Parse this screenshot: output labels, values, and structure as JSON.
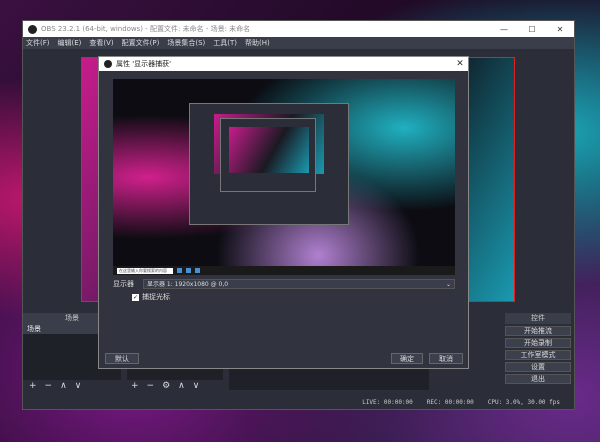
{
  "window": {
    "title": "OBS 23.2.1 (64-bit, windows) - 配置文件: 未命名 - 场景: 未命名",
    "controls": [
      "—",
      "☐",
      "✕"
    ]
  },
  "menu": [
    "文件(F)",
    "编辑(E)",
    "查看(V)",
    "配置文件(P)",
    "场景集合(S)",
    "工具(T)",
    "帮助(H)"
  ],
  "panels": {
    "scenes_title": "场景",
    "scenes_items": [
      "场景"
    ],
    "controls_title": "控件"
  },
  "controls": [
    "开始推流",
    "开始录制",
    "工作室模式",
    "设置",
    "退出"
  ],
  "toolbar_icons": [
    "+",
    "−",
    "∧",
    "∨"
  ],
  "sources_toolbar_icons": [
    "+",
    "−",
    "⚙",
    "∧",
    "∨"
  ],
  "status": {
    "live": "LIVE: 00:00:00",
    "rec": "REC: 00:00:00",
    "cpu": "CPU: 3.0%, 30.00 fps"
  },
  "dialog": {
    "title": "属性 '显示器捕获'",
    "display_label": "显示器",
    "display_value": "显示器 1: 1920x1080 @ 0,0",
    "capture_cursor_label": "捕捉光标",
    "capture_cursor_checked": true,
    "defaults_button": "默认",
    "ok_button": "确定",
    "cancel_button": "取消",
    "taskbar_search": "在这里输入你要搜索的内容"
  }
}
